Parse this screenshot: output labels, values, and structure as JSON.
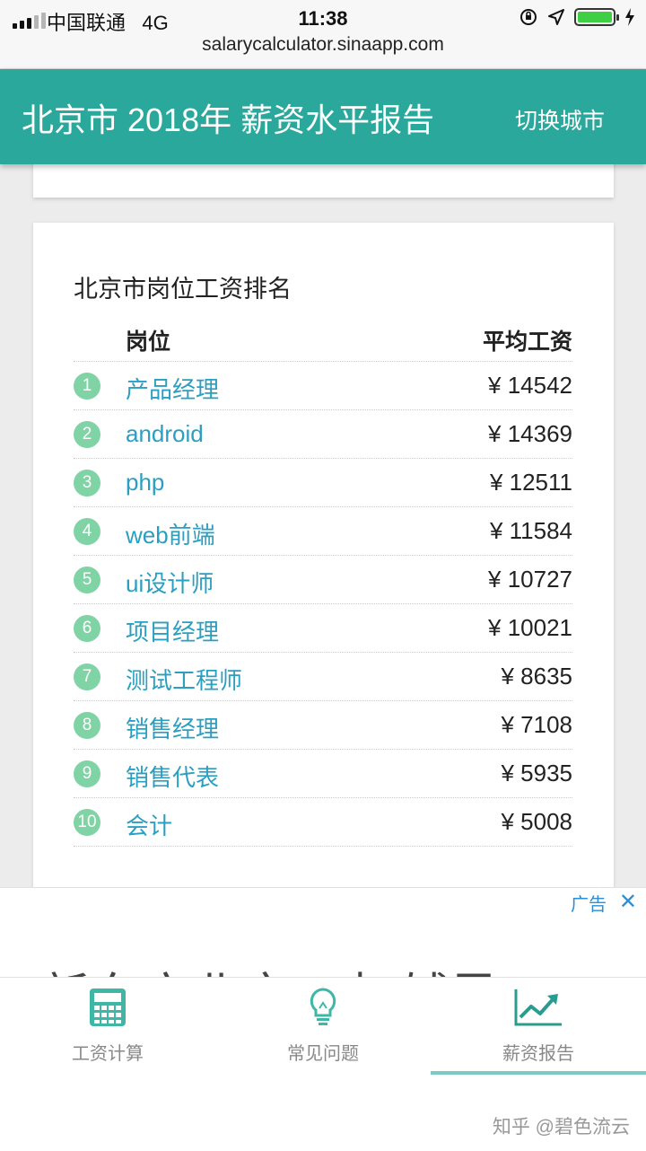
{
  "status_bar": {
    "carrier": "中国联通",
    "network": "4G",
    "time": "11:38",
    "url": "salarycalculator.sinaapp.com",
    "battery_color": "#3ecf45"
  },
  "header": {
    "title": "北京市 2018年 薪资水平报告",
    "switch_city": "切换城市",
    "color": "#2aa89b"
  },
  "ranking": {
    "title": "北京市岗位工资排名",
    "col_position": "岗位",
    "col_salary": "平均工资",
    "rows": [
      {
        "rank": "1",
        "name": "产品经理",
        "salary": "¥ 14542"
      },
      {
        "rank": "2",
        "name": "android",
        "salary": "¥ 14369"
      },
      {
        "rank": "3",
        "name": "php",
        "salary": "¥ 12511"
      },
      {
        "rank": "4",
        "name": "web前端",
        "salary": "¥ 11584"
      },
      {
        "rank": "5",
        "name": "ui设计师",
        "salary": "¥ 10727"
      },
      {
        "rank": "6",
        "name": "项目经理",
        "salary": "¥ 10021"
      },
      {
        "rank": "7",
        "name": "测试工程师",
        "salary": "¥ 8635"
      },
      {
        "rank": "8",
        "name": "销售经理",
        "salary": "¥ 7108"
      },
      {
        "rank": "9",
        "name": "销售代表",
        "salary": "¥ 5935"
      },
      {
        "rank": "10",
        "name": "会计",
        "salary": "¥ 5008"
      }
    ]
  },
  "ad": {
    "label": "广告",
    "close": "✕",
    "text": "新东方北京1对1辅导"
  },
  "tabs": [
    {
      "label": "工资计算",
      "icon": "calculator-icon"
    },
    {
      "label": "常见问题",
      "icon": "lightbulb-icon"
    },
    {
      "label": "薪资报告",
      "icon": "trend-chart-icon",
      "active": true
    }
  ],
  "watermark": "知乎 @碧色流云"
}
